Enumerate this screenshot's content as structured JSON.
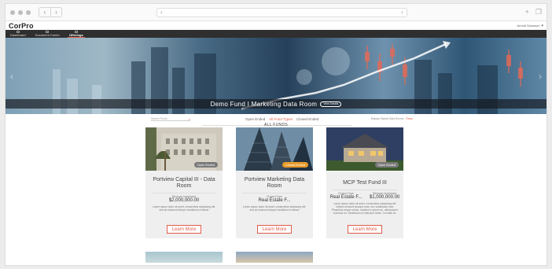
{
  "app": {
    "logo": "CorPro",
    "user_name": "Amold Swanson"
  },
  "nav": [
    {
      "label": "Dashboard"
    },
    {
      "label": "Document Center"
    },
    {
      "label": "Offerings"
    }
  ],
  "hero": {
    "title": "Demo Fund I Marketing Data Room",
    "button_label": "View Details"
  },
  "filters": {
    "search_placeholder": "Search Funds",
    "status_tabs": [
      "Open Ended",
      "All Fund Types",
      "Closed Ended"
    ],
    "active_status": "All Fund Types",
    "display_option": "Display Shared Data Rooms",
    "reset_label": "Reset"
  },
  "section_title": "ALL FUNDS",
  "cards": [
    {
      "badge": "Open Ended",
      "badge_color": "#7a7a7a",
      "title": "Portview Capital III - Data Room",
      "meta_label": "Minimum Investment",
      "meta_value": "$2,000,000.00",
      "description": "Lorem ipsum dolor sit amet, consectetur adipiscing elit, sed do eiusmod tempor incididunt ut labore",
      "cta": "Learn More"
    },
    {
      "badge": "Closed Ended",
      "badge_color": "#e79a2a",
      "title": "Portview Marketing Data Room",
      "meta_label": "Product Type",
      "meta_value": "Real Estate F...",
      "description": "Lorem ipsum dolor sit amet, consectetur adipiscing elit, sed do eiusmod tempor incididunt ut labore",
      "cta": "Learn More"
    },
    {
      "badge": "Open Ended",
      "badge_color": "#7a7a7a",
      "title": "MCP Test Fund III",
      "meta_label_1": "Product Type",
      "meta_value_1": "Real Estate F...",
      "meta_label_2": "Minimum Investment",
      "meta_value_2": "$1,000,000.00",
      "description": "Lorem ipsum dolor sit amet, consectetur adipiscing elit. Nullam sit amet suscipit urna, nec vestibulum erat. Phasellus neque metus, sodales in ipsum ac, ullamcorper euismod mi. Vestibulum et interdum lorem, in mollis ex.",
      "cta": "Learn More"
    }
  ],
  "colors": {
    "accent": "#e15c4a",
    "nav_bg": "#2f2f2f"
  }
}
